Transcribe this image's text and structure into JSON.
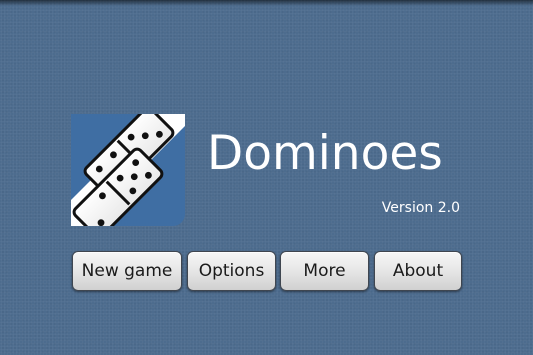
{
  "app": {
    "title": "Dominoes",
    "version": "Version 2.0",
    "logo_icon": "dominoes-logo-icon"
  },
  "menu": {
    "buttons": [
      {
        "label": "New game"
      },
      {
        "label": "Options"
      },
      {
        "label": "More"
      },
      {
        "label": "About"
      }
    ]
  },
  "colors": {
    "background": "#4d6c8e",
    "logo_blue": "#3f6ea3",
    "text": "#ffffff",
    "button_text": "#1a1a1a"
  }
}
